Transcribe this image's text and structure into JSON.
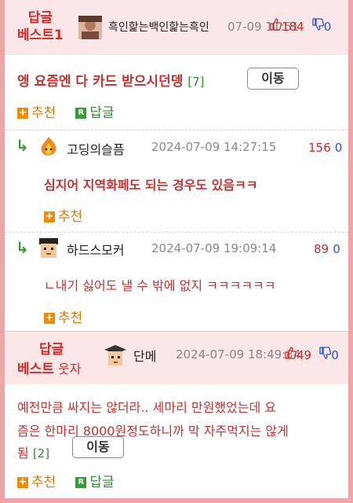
{
  "top_best": {
    "badge_line1": "답글",
    "badge_line2": "베스트1",
    "nickname": "흑인핥는백인핥는흑인",
    "date": "07-09 11:51",
    "up": "184",
    "down": "0",
    "title": "엥 요즘엔 다 카드 받으시던뎅",
    "reply_count": "[7]",
    "move_label": "이동",
    "recommend_label": "추천",
    "reply_label": "답글"
  },
  "comments": [
    {
      "nickname": "고딩의슬픔",
      "date": "2024-07-09 14:27:15",
      "up": "156",
      "down": "0",
      "text": "심지어 지역화페도 되는 경우도 있음ㅋㅋ",
      "bold": true,
      "recommend_label": "추천"
    },
    {
      "nickname": "하드스모커",
      "date": "2024-07-09 19:09:14",
      "up": "89",
      "down": "0",
      "text": "ㄴ내기 싫어도 낼 수 밖에 없지 ㅋㅋㅋㅋㅋㅋ",
      "bold": false,
      "recommend_label": "추천"
    }
  ],
  "bottom_best": {
    "badge_line1": "답글",
    "badge_line2": "베스트",
    "badge_suffix": "웃자",
    "nickname": "단메",
    "date": "2024-07-09 18:49:34",
    "up": "49",
    "down": "0",
    "body_line1": "예전만큼 싸지는 않더라.. 세마리 만원했었는데 요",
    "body_line2": "즘은 한마리 8000원정도하니까 막 자주먹지는 않게",
    "body_line3": "됨",
    "reply_count": "[2]",
    "move_label": "이동",
    "recommend_label": "추천",
    "reply_label": "답글"
  },
  "colors": {
    "border": "#f0a4a8",
    "best_bg": "#fbe6e8",
    "accent_red": "#c93030",
    "reply_green": "#2e8b2e",
    "recommend_orange": "#e07800",
    "down_blue": "#2a52c9"
  }
}
